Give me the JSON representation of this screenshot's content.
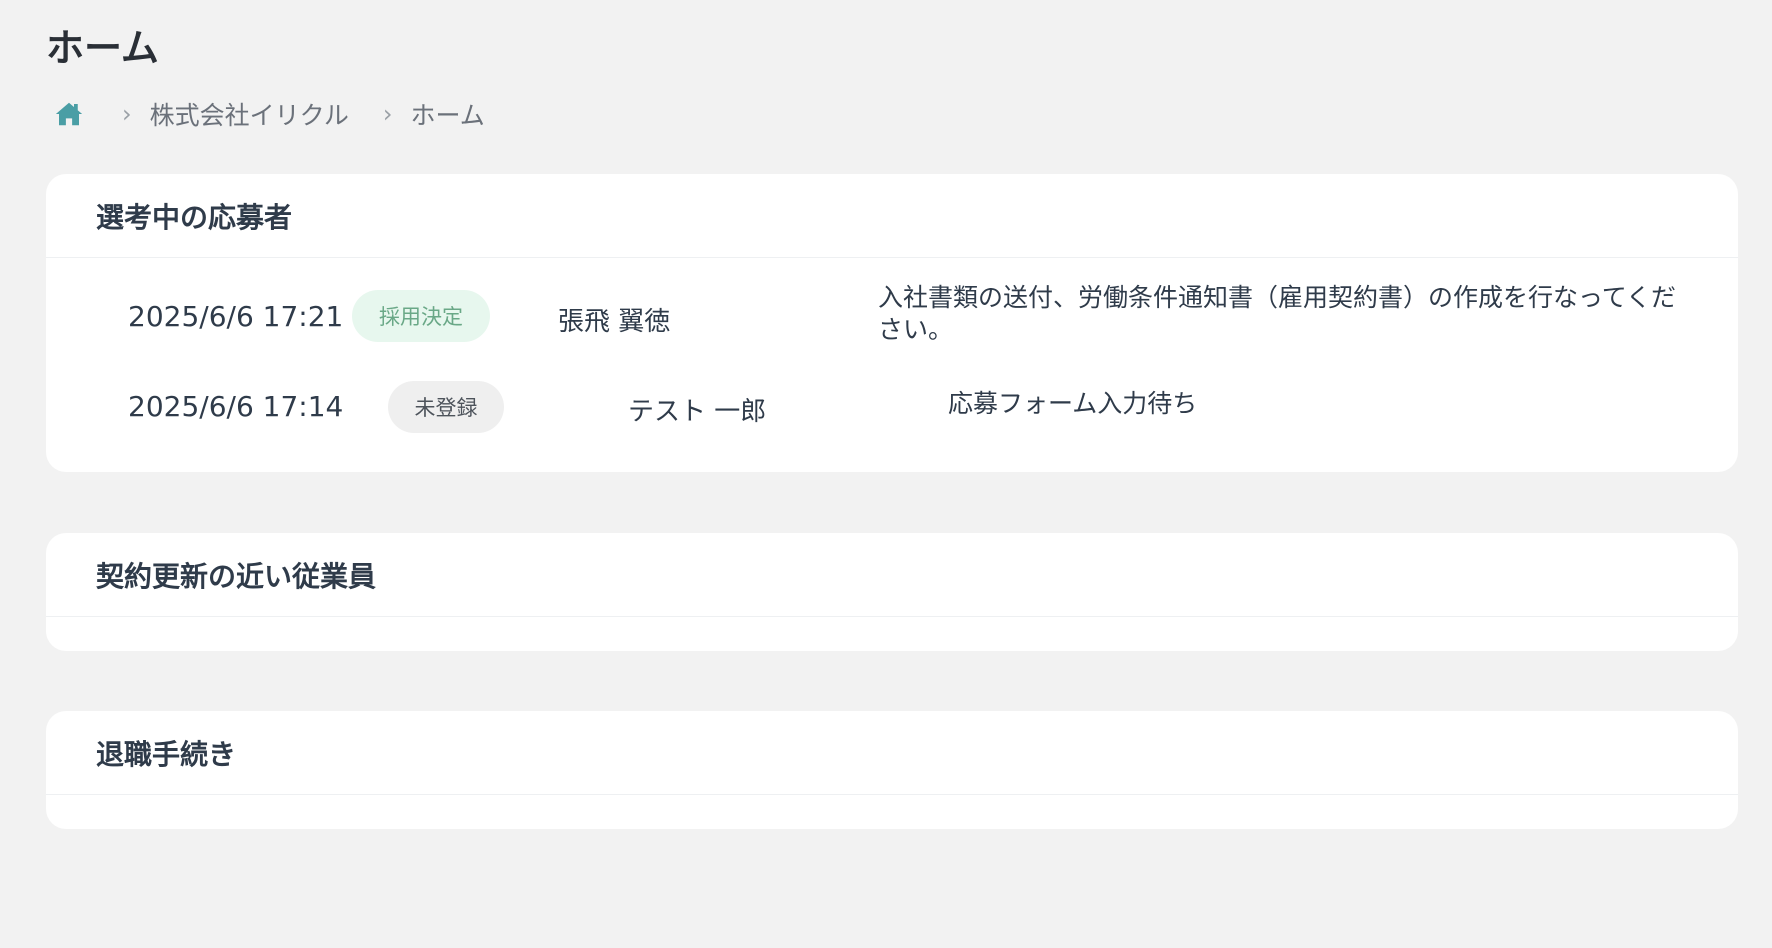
{
  "page": {
    "title": "ホーム"
  },
  "breadcrumb": {
    "home_icon": "home-icon",
    "separator": "›",
    "items": [
      "株式会社イリクル",
      "ホーム"
    ]
  },
  "colors": {
    "background": "#f2f2f2",
    "card": "#ffffff",
    "text": "#2f3b4a",
    "home_icon": "#4a9ea5",
    "badge_hired_bg": "#e7f7ee",
    "badge_hired_text": "#6aa887",
    "badge_unregistered_bg": "#efefef",
    "badge_unregistered_text": "#4d535b"
  },
  "sections": {
    "applicants": {
      "title": "選考中の応募者",
      "rows": [
        {
          "date": "2025/6/6 17:21",
          "status": "採用決定",
          "name": "張飛 翼徳",
          "message": "入社書類の送付、労働条件通知書（雇用契約書）の作成を行なってください。"
        },
        {
          "date": "2025/6/6 17:14",
          "status": "未登録",
          "name": "テスト 一郎",
          "message": "応募フォーム入力待ち"
        }
      ]
    },
    "contract_renewal": {
      "title": "契約更新の近い従業員"
    },
    "retirement": {
      "title": "退職手続き"
    }
  }
}
